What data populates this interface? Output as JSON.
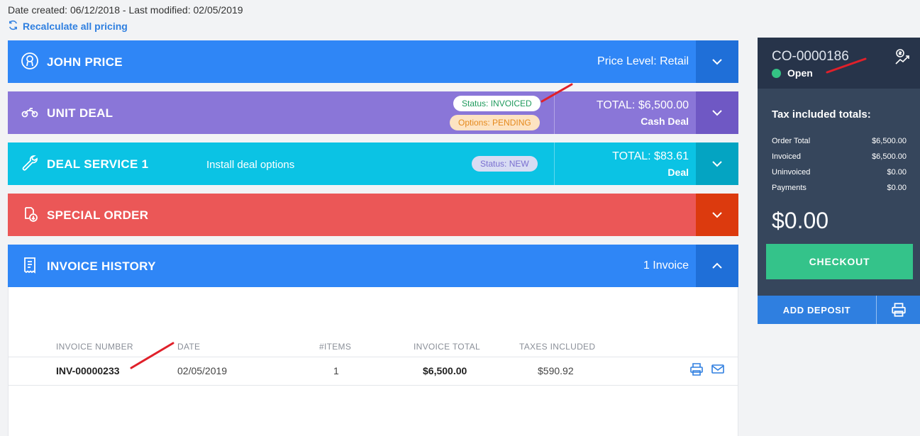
{
  "header": {
    "dates": "Date created: 06/12/2018 - Last modified: 02/05/2019",
    "recalc_label": "Recalculate all pricing"
  },
  "customer": {
    "name": "JOHN PRICE",
    "price_level": "Price Level: Retail",
    "icon": "user-circle-icon"
  },
  "unit_deal": {
    "title": "UNIT DEAL",
    "status": "Status: INVOICED",
    "options": "Options: PENDING",
    "total": "TOTAL: $6,500.00",
    "type": "Cash Deal",
    "icon": "motorcycle-icon"
  },
  "deal_service": {
    "title": "DEAL SERVICE 1",
    "description": "Install deal options",
    "status": "Status: NEW",
    "total": "TOTAL: $83.61",
    "type": "Deal",
    "icon": "wrench-icon"
  },
  "special_order": {
    "title": "SPECIAL ORDER",
    "icon": "clipboard-download-icon"
  },
  "invoice_history": {
    "title": "INVOICE HISTORY",
    "count": "1 Invoice",
    "icon": "receipt-icon",
    "columns": [
      "INVOICE NUMBER",
      "DATE",
      "#ITEMS",
      "INVOICE TOTAL",
      "TAXES INCLUDED"
    ],
    "rows": [
      {
        "number": "INV-00000233",
        "date": "02/05/2019",
        "items": "1",
        "total": "$6,500.00",
        "taxes": "$590.92"
      }
    ]
  },
  "order": {
    "id": "CO-0000186",
    "status": "Open",
    "tax_title": "Tax included totals:",
    "totals": [
      {
        "label": "Order Total",
        "value": "$6,500.00"
      },
      {
        "label": "Invoiced",
        "value": "$6,500.00"
      },
      {
        "label": "Uninvoiced",
        "value": "$0.00"
      },
      {
        "label": "Payments",
        "value": "$0.00"
      }
    ],
    "balance": "$0.00",
    "checkout_label": "CHECKOUT",
    "deposit_label": "ADD DEPOSIT"
  },
  "colors": {
    "blue": "#2f86f6",
    "purple": "#8a76d8",
    "cyan": "#0bc3e4",
    "red": "#eb5757",
    "sidebar": "#36465c",
    "green": "#34c38a",
    "annotation": "#e0202a"
  }
}
